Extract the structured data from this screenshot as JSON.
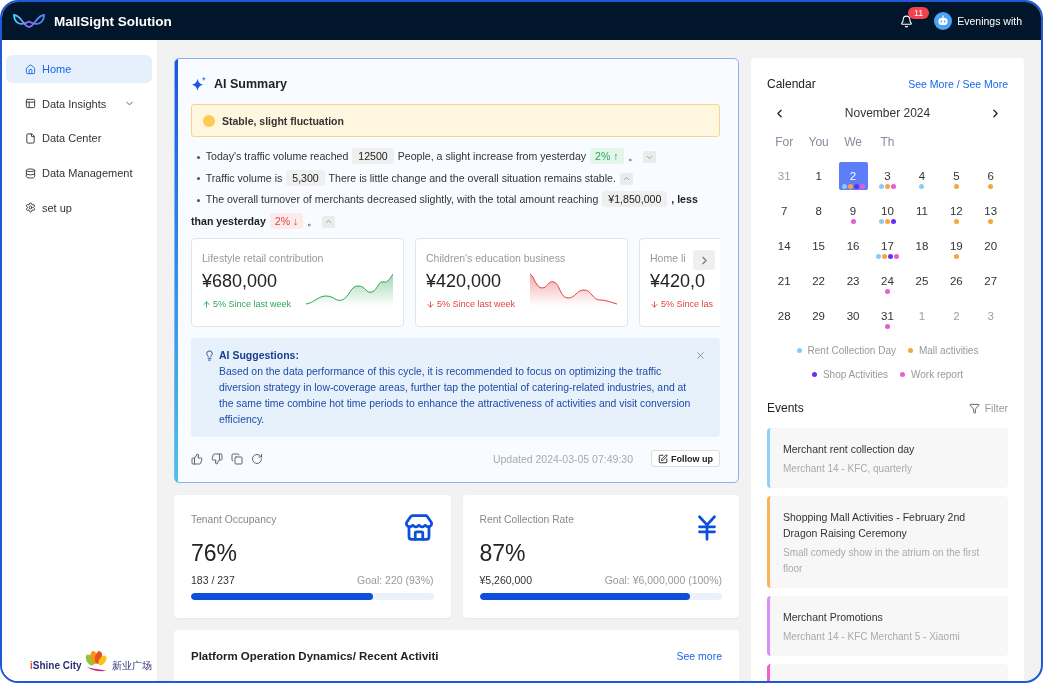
{
  "header": {
    "title": "MallSight Solution",
    "notifications": "11",
    "user": "Evenings with"
  },
  "sidebar": {
    "items": [
      {
        "label": "Home",
        "kind": "link",
        "selected": true
      },
      {
        "label": "Data Insights",
        "kind": "group",
        "selected": false,
        "expanded": false
      },
      {
        "label": "Data Center",
        "kind": "link",
        "selected": false
      },
      {
        "label": "Data Management",
        "kind": "link",
        "selected": false
      },
      {
        "label": "set up",
        "kind": "link",
        "selected": false
      }
    ],
    "logo": {
      "name": "iShine City",
      "name_cn": "新业广场"
    }
  },
  "ai_summary": {
    "title": "AI Summary",
    "status": "Stable, slight fluctuation",
    "bullets": [
      {
        "expanded": false,
        "parts": [
          {
            "kind": "text",
            "text": "Today's traffic volume reached"
          },
          {
            "kind": "value",
            "text": "12500"
          },
          {
            "kind": "text",
            "text": "People, a slight increase from yesterday"
          },
          {
            "kind": "up",
            "text": "2% ↑"
          },
          {
            "kind": "text",
            "text": "。"
          }
        ]
      },
      {
        "expanded": true,
        "parts": [
          {
            "kind": "text",
            "text": "Traffic volume is"
          },
          {
            "kind": "value",
            "text": "5,300"
          },
          {
            "kind": "text",
            "text": "There is little change and the overall situation remains stable."
          }
        ]
      },
      {
        "expanded": true,
        "parts": [
          {
            "kind": "text",
            "text": "The overall turnover of merchants decreased slightly, with the total amount reaching"
          },
          {
            "kind": "value",
            "text": "¥1,850,000"
          },
          {
            "kind": "strong",
            "text": ", less"
          },
          {
            "kind": "strong",
            "text": "than yesterday"
          },
          {
            "kind": "down",
            "text": "2% ↓"
          },
          {
            "kind": "text",
            "text": "。"
          }
        ]
      }
    ],
    "metrics": [
      {
        "title": "Lifestyle retail contribution",
        "value": "¥680,000",
        "rising": true,
        "change": "5% Since last week",
        "cut": false
      },
      {
        "title": "Children's education business",
        "value": "¥420,000",
        "rising": false,
        "change": "5% Since last week",
        "cut": false
      },
      {
        "title": "Home li",
        "value": "¥420,0",
        "rising": false,
        "change": "5% Since las",
        "cut": true
      }
    ],
    "suggestions": {
      "title": "AI Suggestions:",
      "text": "Based on the data performance of this cycle, it is recommended to focus on optimizing the traffic diversion strategy in low-coverage areas, further tap the potential of catering-related industries, and at the same time combine hot time periods to enhance the attractiveness of activities and visit conversion efficiency."
    },
    "updated": "Updated 2024-03-05 07:49:30",
    "follow_up": "Follow up"
  },
  "stats": [
    {
      "label": "Tenant Occupancy",
      "value": "76%",
      "count": "183 / 237",
      "goal": "Goal: 220 (93%)",
      "level": 0.75
    },
    {
      "label": "Rent Collection Rate",
      "value": "87%",
      "count": "¥5,260,000",
      "goal": "Goal: ¥6,000,000 (100%)",
      "level": 0.87
    }
  ],
  "activity": {
    "title": "Platform Operation Dynamics/ Recent Activiti",
    "link": "See more"
  },
  "calendar": {
    "title": "Calendar",
    "link": "See More / See More",
    "month": "November 2024",
    "weekdays": [
      "For",
      "You",
      "We",
      "Th"
    ],
    "weeks": [
      [
        {
          "day": "31",
          "other_month": true,
          "selected": false
        },
        {
          "day": "1",
          "other_month": false,
          "selected": false
        },
        {
          "day": "2",
          "other_month": false,
          "selected": true,
          "dots": [
            {
              "color": "#86cdf3"
            },
            {
              "color": "#f9a53c"
            },
            {
              "color": "#6b2cf5"
            },
            {
              "color": "#e55fd0"
            }
          ]
        },
        {
          "day": "3",
          "other_month": false,
          "selected": false,
          "dots": [
            {
              "color": "#86cdf3"
            },
            {
              "color": "#f9a53c"
            },
            {
              "color": "#e55fd0"
            }
          ]
        },
        {
          "day": "4",
          "other_month": false,
          "selected": false,
          "dots": [
            {
              "color": "#86cdf3"
            }
          ]
        },
        {
          "day": "5",
          "other_month": false,
          "selected": false,
          "dots": [
            {
              "color": "#f9a53c"
            }
          ]
        },
        {
          "day": "6",
          "other_month": false,
          "selected": false,
          "dots": [
            {
              "color": "#f9a53c"
            }
          ]
        }
      ],
      [
        {
          "day": "7",
          "other_month": false,
          "selected": false
        },
        {
          "day": "8",
          "other_month": false,
          "selected": false
        },
        {
          "day": "9",
          "other_month": false,
          "selected": false,
          "dots": [
            {
              "color": "#e55fd0"
            }
          ]
        },
        {
          "day": "10",
          "other_month": false,
          "selected": false,
          "dots": [
            {
              "color": "#86cdf3"
            },
            {
              "color": "#f9a53c"
            },
            {
              "color": "#6b2cf5"
            }
          ]
        },
        {
          "day": "11",
          "other_month": false,
          "selected": false
        },
        {
          "day": "12",
          "other_month": false,
          "selected": false,
          "dots": [
            {
              "color": "#f9a53c"
            }
          ]
        },
        {
          "day": "13",
          "other_month": false,
          "selected": false,
          "dots": [
            {
              "color": "#f9a53c"
            }
          ]
        }
      ],
      [
        {
          "day": "14",
          "other_month": false,
          "selected": false
        },
        {
          "day": "15",
          "other_month": false,
          "selected": false
        },
        {
          "day": "16",
          "other_month": false,
          "selected": false
        },
        {
          "day": "17",
          "other_month": false,
          "selected": false,
          "dots": [
            {
              "color": "#86cdf3"
            },
            {
              "color": "#f9a53c"
            },
            {
              "color": "#6b2cf5"
            },
            {
              "color": "#e55fd0"
            }
          ]
        },
        {
          "day": "18",
          "other_month": false,
          "selected": false
        },
        {
          "day": "19",
          "other_month": false,
          "selected": false,
          "dots": [
            {
              "color": "#f9a53c"
            }
          ]
        },
        {
          "day": "20",
          "other_month": false,
          "selected": false
        }
      ],
      [
        {
          "day": "21",
          "other_month": false,
          "selected": false
        },
        {
          "day": "22",
          "other_month": false,
          "selected": false
        },
        {
          "day": "23",
          "other_month": false,
          "selected": false
        },
        {
          "day": "24",
          "other_month": false,
          "selected": false,
          "dots": [
            {
              "color": "#e55fd0"
            }
          ]
        },
        {
          "day": "25",
          "other_month": false,
          "selected": false
        },
        {
          "day": "26",
          "other_month": false,
          "selected": false
        },
        {
          "day": "27",
          "other_month": false,
          "selected": false
        }
      ],
      [
        {
          "day": "28",
          "other_month": false,
          "selected": false
        },
        {
          "day": "29",
          "other_month": false,
          "selected": false
        },
        {
          "day": "30",
          "other_month": false,
          "selected": false
        },
        {
          "day": "31",
          "other_month": false,
          "selected": false,
          "dots": [
            {
              "color": "#e55fd0"
            }
          ]
        },
        {
          "day": "1",
          "other_month": true,
          "selected": false
        },
        {
          "day": "2",
          "other_month": true,
          "selected": false
        },
        {
          "day": "3",
          "other_month": true,
          "selected": false
        }
      ]
    ],
    "legend": [
      {
        "label": "Rent Collection Day",
        "color": "#86cdf3"
      },
      {
        "label": "Mall activities",
        "color": "#f9a53c"
      },
      {
        "label": "Shop Activities",
        "color": "#6b2cf5"
      },
      {
        "label": "Work report",
        "color": "#e55fd0"
      }
    ]
  },
  "events": {
    "title": "Events",
    "filter": "Filter",
    "items": [
      {
        "title": "Merchant rent collection day",
        "description": "Merchant 14 - KFC, quarterly",
        "color": "#8fd0f8"
      },
      {
        "title": "Shopping Mall Activities - February 2nd Dragon Raising Ceremony",
        "description": "Small comedy show in the atrium on the first floor",
        "color": "#fbb05a"
      },
      {
        "title": "Merchant Promotions",
        "description": "Merchant 14 - KFC Merchant 5 - Xiaomi",
        "color": "#d98ef5"
      },
      {
        "color": "#f35fd3"
      }
    ]
  }
}
